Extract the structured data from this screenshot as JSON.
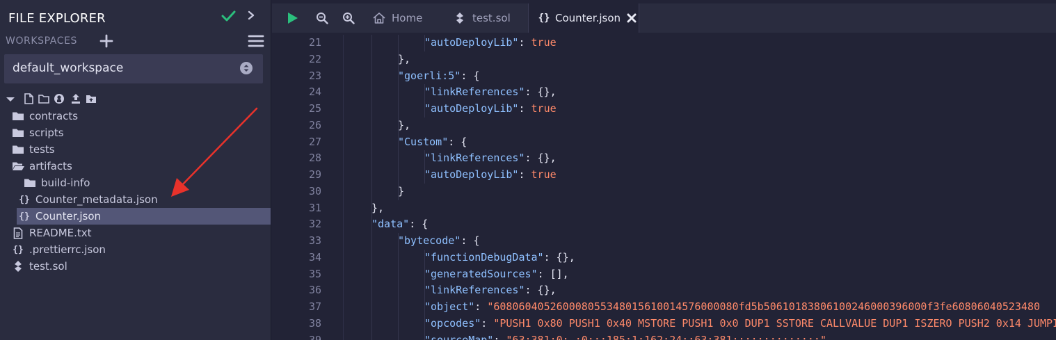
{
  "sidebar": {
    "title": "FILE EXPLORER",
    "workspaces_label": "WORKSPACES",
    "workspace_selected": "default_workspace",
    "tree": [
      {
        "label": "contracts",
        "icon": "folder-icon",
        "depth": 0
      },
      {
        "label": "scripts",
        "icon": "folder-icon",
        "depth": 0
      },
      {
        "label": "tests",
        "icon": "folder-icon",
        "depth": 0
      },
      {
        "label": "artifacts",
        "icon": "folder-open-icon",
        "depth": 0
      },
      {
        "label": "build-info",
        "icon": "folder-icon",
        "depth": 1
      },
      {
        "label": "Counter_metadata.json",
        "icon": "json-file-icon",
        "depth": 1
      },
      {
        "label": "Counter.json",
        "icon": "json-file-icon",
        "depth": 1,
        "selected": true
      },
      {
        "label": "README.txt",
        "icon": "text-file-icon",
        "depth": 0
      },
      {
        "label": ".prettierrc.json",
        "icon": "json-file-icon",
        "depth": 0
      },
      {
        "label": "test.sol",
        "icon": "solidity-file-icon",
        "depth": 0
      }
    ]
  },
  "tabs": [
    {
      "label": "Home",
      "icon": "home-icon"
    },
    {
      "label": "test.sol",
      "icon": "solidity-file-icon"
    },
    {
      "label": "Counter.json",
      "icon": "json-file-icon",
      "active": true
    }
  ],
  "colors": {
    "key": "#8fc0ff",
    "value": "#ff8a6a",
    "accent_green": "#2bbf7d",
    "selection": "#535677",
    "annotation_arrow": "#e8322b"
  },
  "code_lines": [
    {
      "n": "21",
      "indent": 3,
      "parts": [
        [
          "k",
          "\"autoDeployLib\""
        ],
        [
          "p",
          ": "
        ],
        [
          "v",
          "true"
        ]
      ]
    },
    {
      "n": "22",
      "indent": 2,
      "parts": [
        [
          "p",
          "},"
        ]
      ]
    },
    {
      "n": "23",
      "indent": 2,
      "parts": [
        [
          "k",
          "\"goerli:5\""
        ],
        [
          "p",
          ": {"
        ]
      ]
    },
    {
      "n": "24",
      "indent": 3,
      "parts": [
        [
          "k",
          "\"linkReferences\""
        ],
        [
          "p",
          ": {},"
        ]
      ]
    },
    {
      "n": "25",
      "indent": 3,
      "parts": [
        [
          "k",
          "\"autoDeployLib\""
        ],
        [
          "p",
          ": "
        ],
        [
          "v",
          "true"
        ]
      ]
    },
    {
      "n": "26",
      "indent": 2,
      "parts": [
        [
          "p",
          "},"
        ]
      ]
    },
    {
      "n": "27",
      "indent": 2,
      "parts": [
        [
          "k",
          "\"Custom\""
        ],
        [
          "p",
          ": {"
        ]
      ]
    },
    {
      "n": "28",
      "indent": 3,
      "parts": [
        [
          "k",
          "\"linkReferences\""
        ],
        [
          "p",
          ": {},"
        ]
      ]
    },
    {
      "n": "29",
      "indent": 3,
      "parts": [
        [
          "k",
          "\"autoDeployLib\""
        ],
        [
          "p",
          ": "
        ],
        [
          "v",
          "true"
        ]
      ]
    },
    {
      "n": "30",
      "indent": 2,
      "parts": [
        [
          "p",
          "}"
        ]
      ]
    },
    {
      "n": "31",
      "indent": 1,
      "parts": [
        [
          "p",
          "},"
        ]
      ]
    },
    {
      "n": "32",
      "indent": 1,
      "parts": [
        [
          "k",
          "\"data\""
        ],
        [
          "p",
          ": {"
        ]
      ]
    },
    {
      "n": "33",
      "indent": 2,
      "parts": [
        [
          "k",
          "\"bytecode\""
        ],
        [
          "p",
          ": {"
        ]
      ]
    },
    {
      "n": "34",
      "indent": 3,
      "parts": [
        [
          "k",
          "\"functionDebugData\""
        ],
        [
          "p",
          ": {},"
        ]
      ]
    },
    {
      "n": "35",
      "indent": 3,
      "parts": [
        [
          "k",
          "\"generatedSources\""
        ],
        [
          "p",
          ": [],"
        ]
      ]
    },
    {
      "n": "36",
      "indent": 3,
      "parts": [
        [
          "k",
          "\"linkReferences\""
        ],
        [
          "p",
          ": {},"
        ]
      ]
    },
    {
      "n": "37",
      "indent": 3,
      "parts": [
        [
          "k",
          "\"object\""
        ],
        [
          "p",
          ": "
        ],
        [
          "v",
          "\"608060405260008055348015610014576000080fd5b50610183806100246000396000f3fe60806040523480"
        ]
      ]
    },
    {
      "n": "38",
      "indent": 3,
      "parts": [
        [
          "k",
          "\"opcodes\""
        ],
        [
          "p",
          ": "
        ],
        [
          "v",
          "\"PUSH1 0x80 PUSH1 0x40 MSTORE PUSH1 0x0 DUP1 SSTORE CALLVALUE DUP1 ISZERO PUSH2 0x14 JUMPI"
        ]
      ]
    },
    {
      "n": "39",
      "indent": 3,
      "parts": [
        [
          "k",
          "\"sourceMap\""
        ],
        [
          "p",
          ": "
        ],
        [
          "v",
          "\"63:381:0:-:0;;;185:1:162:24;;63:381;;;;;;;;;;;;;;\""
        ]
      ]
    }
  ]
}
